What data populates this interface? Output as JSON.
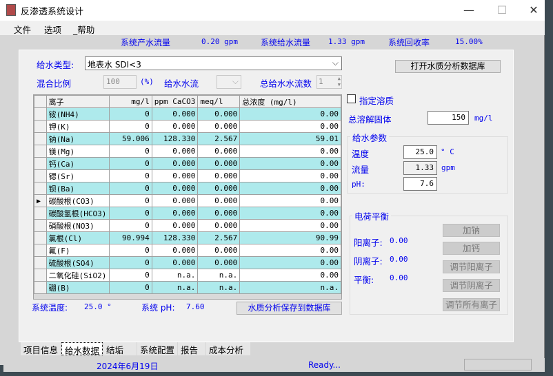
{
  "window": {
    "title": "反渗透系统设计",
    "minimize": "—",
    "maximize": "☐",
    "close": "✕"
  },
  "menu": [
    "文件",
    "选项",
    "_帮助"
  ],
  "summary": {
    "product_label": "系统产水流量",
    "product_value": "0.20 gpm",
    "feed_label": "系统给水流量",
    "feed_value": "1.33 gpm",
    "recovery_label": "系统回收率",
    "recovery_value": "15.00%"
  },
  "feed": {
    "type_label": "给水类型:",
    "type_value": "地表水 SDI<3",
    "open_db_button": "打开水质分析数据库",
    "mix_label": "混合比例",
    "mix_value": "100",
    "mix_unit": "(%)",
    "stream_label": "给水水流",
    "total_streams_label": "总给水水流数",
    "total_streams_value": "1"
  },
  "table": {
    "columns": [
      "离子",
      "mg/l",
      "ppm CaCO3",
      "meq/l",
      "总浓度 (mg/l)"
    ],
    "rows": [
      [
        "铵(NH4)",
        "0",
        "0.000",
        "0.000",
        "0.00"
      ],
      [
        "钾(K)",
        "0",
        "0.000",
        "0.000",
        "0.00"
      ],
      [
        "钠(Na)",
        "59.006",
        "128.330",
        "2.567",
        "59.01"
      ],
      [
        "镁(Mg)",
        "0",
        "0.000",
        "0.000",
        "0.00"
      ],
      [
        "钙(Ca)",
        "0",
        "0.000",
        "0.000",
        "0.00"
      ],
      [
        "锶(Sr)",
        "0",
        "0.000",
        "0.000",
        "0.00"
      ],
      [
        "钡(Ba)",
        "0",
        "0.000",
        "0.000",
        "0.00"
      ],
      [
        "碳酸根(CO3)",
        "0",
        "0.000",
        "0.000",
        "0.00"
      ],
      [
        "碳酸氢根(HCO3)",
        "0",
        "0.000",
        "0.000",
        "0.00"
      ],
      [
        "硝酸根(NO3)",
        "0",
        "0.000",
        "0.000",
        "0.00"
      ],
      [
        "氯根(Cl)",
        "90.994",
        "128.330",
        "2.567",
        "90.99"
      ],
      [
        "氟(F)",
        "0",
        "0.000",
        "0.000",
        "0.00"
      ],
      [
        "硫酸根(SO4)",
        "0",
        "0.000",
        "0.000",
        "0.00"
      ],
      [
        "二氧化硅(SiO2)",
        "0",
        "n.a.",
        "n.a.",
        "0.00"
      ],
      [
        "硼(B)",
        "0",
        "n.a.",
        "n.a.",
        "n.a."
      ]
    ],
    "current_row": 7
  },
  "footer": {
    "temp_label": "系统温度:",
    "temp_value": "25.0 °",
    "ph_label": "系统 pH:",
    "ph_value": "7.60",
    "save_button": "水质分析保存到数据库"
  },
  "right": {
    "specify_solute": "指定溶质",
    "tds_label": "总溶解固体",
    "tds_value": "150",
    "tds_unit": "mg/l",
    "params": {
      "title": "给水参数",
      "temp_label": "温度",
      "temp_value": "25.0",
      "temp_unit": "° C",
      "flow_label": "流量",
      "flow_value": "1.33",
      "flow_unit": "gpm",
      "ph_label": "pH:",
      "ph_value": "7.6"
    },
    "balance": {
      "title": "电荷平衡",
      "cation_label": "阳离子:",
      "cation_value": "0.00",
      "anion_label": "阴离子:",
      "anion_value": "0.00",
      "balance_label": "平衡:",
      "balance_value": "0.00",
      "buttons": [
        "加钠",
        "加钙",
        "调节阳离子",
        "调节阴离子",
        "调节所有离子"
      ]
    }
  },
  "tabs": [
    "项目信息",
    "给水数据",
    "结垢",
    "系统配置",
    "报告",
    "成本分析"
  ],
  "active_tab": 1,
  "status": {
    "date": "2024年6月19日",
    "message": "Ready..."
  }
}
